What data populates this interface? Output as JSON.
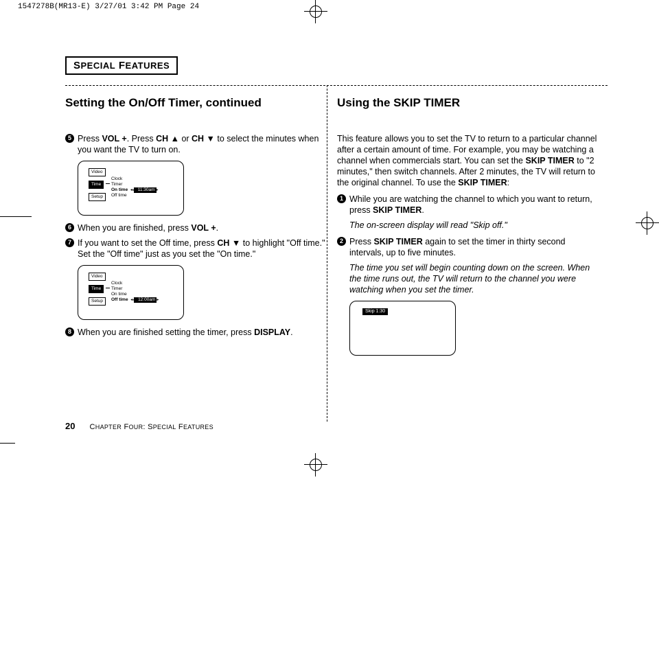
{
  "print_slug": "1547278B(MR13-E)  3/27/01 3:42 PM  Page 24",
  "section_header": "SPECIAL FEATURES",
  "footer": {
    "page_number": "20",
    "chapter": "Chapter Four: Special Features"
  },
  "left": {
    "heading": "Setting the On/Off Timer, continued",
    "steps": {
      "s5": {
        "n": "5",
        "pre": "Press ",
        "b1": "VOL +",
        "mid1": ". Press ",
        "b2": "CH ▲",
        "mid2": " or ",
        "b3": "CH ▼",
        "tail": " to select the minutes when you want the TV to turn on."
      },
      "s6": {
        "n": "6",
        "pre": "When you are finished, press ",
        "b1": "VOL +",
        "tail": "."
      },
      "s7": {
        "n": "7",
        "pre": "If you want to set the Off time, press ",
        "b1": "CH ▼",
        "tail": " to highlight \"Off time.\" Set the \"Off time\" just as you set the \"On time.\""
      },
      "s8": {
        "n": "8",
        "pre": "When you are finished setting the timer, press ",
        "b1": "DISPLAY",
        "tail": "."
      }
    },
    "tv1": {
      "tab_video": "Video",
      "tab_time": "Time",
      "tab_setup": "Setup",
      "menu": {
        "clock": "Clock",
        "timer": "Timer",
        "on_time": "On time",
        "off_time": "Off time"
      },
      "highlight_time": true,
      "selected_row": "On time",
      "value": "11:30am"
    },
    "tv2": {
      "tab_video": "Video",
      "tab_time": "Time",
      "tab_setup": "Setup",
      "menu": {
        "clock": "Clock",
        "timer": "Timer",
        "on_time": "On time",
        "off_time": "Off time"
      },
      "highlight_time": true,
      "selected_row": "Off time",
      "value": "12:00am"
    }
  },
  "right": {
    "heading": "Using the SKIP TIMER",
    "intro": {
      "p1a": "This feature allows you to set the TV to return to a particular channel after a certain amount of time. For example, you may be watching a channel when commercials start. You can set the ",
      "b1": "SKIP TIMER",
      "p1b": " to \"2 minutes,\" then switch channels. After 2 minutes, the TV will return to the original channel. To use the ",
      "b2": "SKIP TIMER",
      "p1c": ":"
    },
    "steps": {
      "s1": {
        "n": "1",
        "pre": "While you are watching the channel to which you want to return, press ",
        "b1": "SKIP TIMER",
        "tail": "."
      },
      "s1_note": "The on-screen display will read \"Skip off.\"",
      "s2": {
        "n": "2",
        "pre": "Press ",
        "b1": "SKIP TIMER",
        "tail": " again to set the timer in thirty second intervals, up to five minutes."
      },
      "s2_note": "The time you set will begin counting down on the screen. When the time runs out, the TV will return to the channel you were watching when you set the timer."
    },
    "tv_skip": {
      "label": "Skip   1:30"
    }
  }
}
